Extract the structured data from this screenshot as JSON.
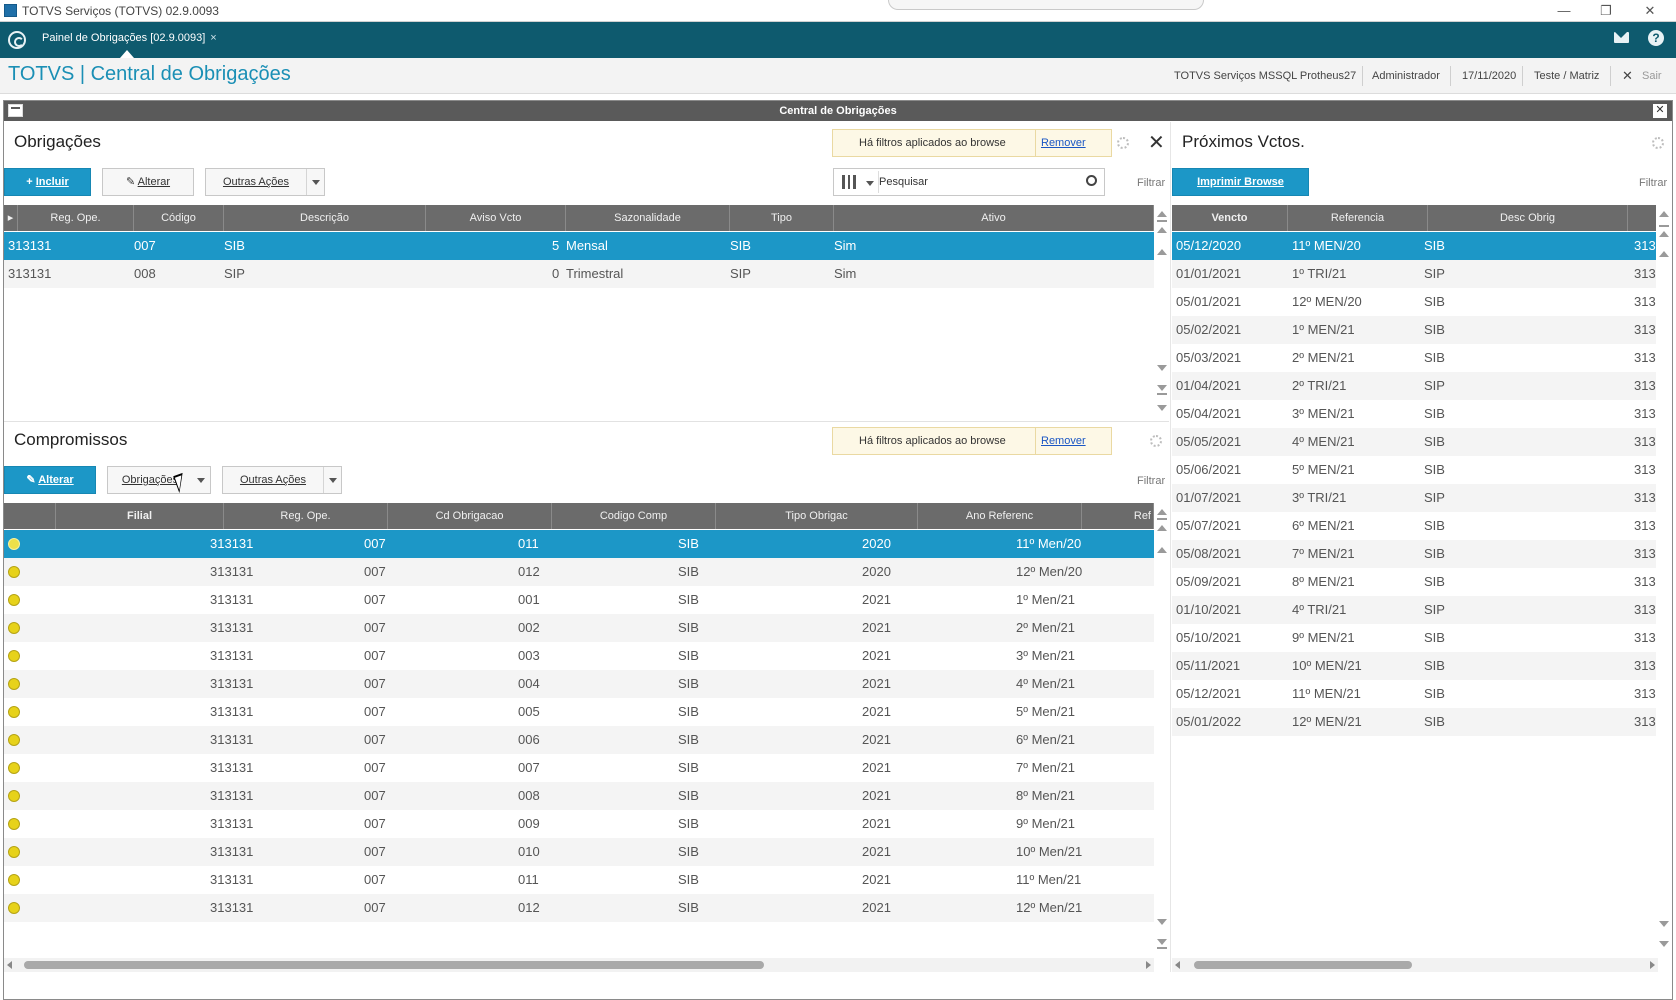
{
  "window_title": "TOTVS Serviços (TOTVS) 02.9.0093",
  "window_controls": {
    "minimize": "—",
    "restore": "❐",
    "close": "✕"
  },
  "tab": {
    "label": "Painel de Obrigações [02.9.0093]",
    "close": "×"
  },
  "header": {
    "brand": "TOTVS | Central de Obrigações",
    "environment": "TOTVS Serviços MSSQL Protheus27",
    "user": "Administrador",
    "date": "17/11/2020",
    "branch": "Teste / Matriz",
    "exit_icon": "✕",
    "exit_label": "Sair"
  },
  "dialog": {
    "title": "Central de Obrigações",
    "close": "✕"
  },
  "obrigacoes": {
    "title": "Obrigações",
    "filter_note": "Há filtros aplicados ao browse",
    "filter_remove": "Remover",
    "close_panel": "✕",
    "btn_incluir": "Incluir",
    "btn_alterar": "Alterar",
    "btn_outras": "Outras Ações",
    "search_placeholder": "Pesquisar",
    "filtrar": "Filtrar",
    "columns": [
      "Reg. Ope.",
      "Código",
      "Descrição",
      "Aviso Vcto",
      "Sazonalidade",
      "Tipo",
      "Ativo"
    ],
    "rows": [
      [
        "313131",
        "007",
        "SIB",
        "5",
        "Mensal",
        "SIB",
        "Sim"
      ],
      [
        "313131",
        "008",
        "SIP",
        "0",
        "Trimestral",
        "SIP",
        "Sim"
      ]
    ]
  },
  "compromissos": {
    "title": "Compromissos",
    "filter_note": "Há filtros aplicados ao browse",
    "filter_remove": "Remover",
    "btn_alterar": "Alterar",
    "btn_obrigacoes": "Obrigações",
    "btn_outras": "Outras Ações",
    "filtrar": "Filtrar",
    "columns": [
      "Filial",
      "Reg. Ope.",
      "Cd Obrigacao",
      "Codigo Comp",
      "Tipo Obrigac",
      "Ano Referenc",
      "Ref"
    ],
    "rows": [
      [
        "313131",
        "007",
        "011",
        "SIB",
        "2020",
        "11º Men/20"
      ],
      [
        "313131",
        "007",
        "012",
        "SIB",
        "2020",
        "12º Men/20"
      ],
      [
        "313131",
        "007",
        "001",
        "SIB",
        "2021",
        "1º Men/21"
      ],
      [
        "313131",
        "007",
        "002",
        "SIB",
        "2021",
        "2º Men/21"
      ],
      [
        "313131",
        "007",
        "003",
        "SIB",
        "2021",
        "3º Men/21"
      ],
      [
        "313131",
        "007",
        "004",
        "SIB",
        "2021",
        "4º Men/21"
      ],
      [
        "313131",
        "007",
        "005",
        "SIB",
        "2021",
        "5º Men/21"
      ],
      [
        "313131",
        "007",
        "006",
        "SIB",
        "2021",
        "6º Men/21"
      ],
      [
        "313131",
        "007",
        "007",
        "SIB",
        "2021",
        "7º Men/21"
      ],
      [
        "313131",
        "007",
        "008",
        "SIB",
        "2021",
        "8º Men/21"
      ],
      [
        "313131",
        "007",
        "009",
        "SIB",
        "2021",
        "9º Men/21"
      ],
      [
        "313131",
        "007",
        "010",
        "SIB",
        "2021",
        "10º Men/21"
      ],
      [
        "313131",
        "007",
        "011",
        "SIB",
        "2021",
        "11º Men/21"
      ],
      [
        "313131",
        "007",
        "012",
        "SIB",
        "2021",
        "12º Men/21"
      ]
    ]
  },
  "proximos": {
    "title": "Próximos Vctos.",
    "btn_imprimir": "Imprimir Browse",
    "filtrar": "Filtrar",
    "columns": [
      "Vencto",
      "Referencia",
      "Desc Obrig"
    ],
    "rows": [
      [
        "05/12/2020",
        "11º MEN/20",
        "SIB",
        "313"
      ],
      [
        "01/01/2021",
        "1º TRI/21",
        "SIP",
        "313"
      ],
      [
        "05/01/2021",
        "12º MEN/20",
        "SIB",
        "313"
      ],
      [
        "05/02/2021",
        "1º MEN/21",
        "SIB",
        "313"
      ],
      [
        "05/03/2021",
        "2º MEN/21",
        "SIB",
        "313"
      ],
      [
        "01/04/2021",
        "2º TRI/21",
        "SIP",
        "313"
      ],
      [
        "05/04/2021",
        "3º MEN/21",
        "SIB",
        "313"
      ],
      [
        "05/05/2021",
        "4º MEN/21",
        "SIB",
        "313"
      ],
      [
        "05/06/2021",
        "5º MEN/21",
        "SIB",
        "313"
      ],
      [
        "01/07/2021",
        "3º TRI/21",
        "SIP",
        "313"
      ],
      [
        "05/07/2021",
        "6º MEN/21",
        "SIB",
        "313"
      ],
      [
        "05/08/2021",
        "7º MEN/21",
        "SIB",
        "313"
      ],
      [
        "05/09/2021",
        "8º MEN/21",
        "SIB",
        "313"
      ],
      [
        "01/10/2021",
        "4º TRI/21",
        "SIP",
        "313"
      ],
      [
        "05/10/2021",
        "9º MEN/21",
        "SIB",
        "313"
      ],
      [
        "05/11/2021",
        "10º MEN/21",
        "SIB",
        "313"
      ],
      [
        "05/12/2021",
        "11º MEN/21",
        "SIB",
        "313"
      ],
      [
        "05/01/2022",
        "12º MEN/21",
        "SIB",
        "313"
      ]
    ]
  },
  "colors": {
    "accent": "#1c97c7",
    "tabbar": "#0e5a6e",
    "brand": "#1a8fb5",
    "status_dot": "#e7d21a"
  }
}
